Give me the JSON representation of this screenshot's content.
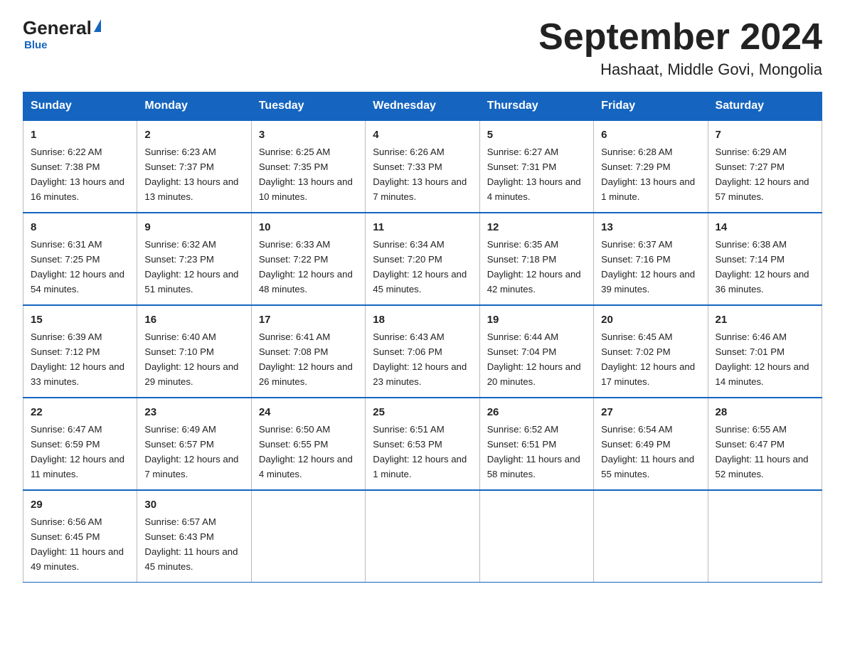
{
  "logo": {
    "general": "General",
    "blue": "Blue",
    "subtitle": "Blue"
  },
  "title": "September 2024",
  "subtitle": "Hashaat, Middle Govi, Mongolia",
  "days": [
    "Sunday",
    "Monday",
    "Tuesday",
    "Wednesday",
    "Thursday",
    "Friday",
    "Saturday"
  ],
  "weeks": [
    [
      {
        "num": "1",
        "sunrise": "6:22 AM",
        "sunset": "7:38 PM",
        "daylight": "13 hours and 16 minutes."
      },
      {
        "num": "2",
        "sunrise": "6:23 AM",
        "sunset": "7:37 PM",
        "daylight": "13 hours and 13 minutes."
      },
      {
        "num": "3",
        "sunrise": "6:25 AM",
        "sunset": "7:35 PM",
        "daylight": "13 hours and 10 minutes."
      },
      {
        "num": "4",
        "sunrise": "6:26 AM",
        "sunset": "7:33 PM",
        "daylight": "13 hours and 7 minutes."
      },
      {
        "num": "5",
        "sunrise": "6:27 AM",
        "sunset": "7:31 PM",
        "daylight": "13 hours and 4 minutes."
      },
      {
        "num": "6",
        "sunrise": "6:28 AM",
        "sunset": "7:29 PM",
        "daylight": "13 hours and 1 minute."
      },
      {
        "num": "7",
        "sunrise": "6:29 AM",
        "sunset": "7:27 PM",
        "daylight": "12 hours and 57 minutes."
      }
    ],
    [
      {
        "num": "8",
        "sunrise": "6:31 AM",
        "sunset": "7:25 PM",
        "daylight": "12 hours and 54 minutes."
      },
      {
        "num": "9",
        "sunrise": "6:32 AM",
        "sunset": "7:23 PM",
        "daylight": "12 hours and 51 minutes."
      },
      {
        "num": "10",
        "sunrise": "6:33 AM",
        "sunset": "7:22 PM",
        "daylight": "12 hours and 48 minutes."
      },
      {
        "num": "11",
        "sunrise": "6:34 AM",
        "sunset": "7:20 PM",
        "daylight": "12 hours and 45 minutes."
      },
      {
        "num": "12",
        "sunrise": "6:35 AM",
        "sunset": "7:18 PM",
        "daylight": "12 hours and 42 minutes."
      },
      {
        "num": "13",
        "sunrise": "6:37 AM",
        "sunset": "7:16 PM",
        "daylight": "12 hours and 39 minutes."
      },
      {
        "num": "14",
        "sunrise": "6:38 AM",
        "sunset": "7:14 PM",
        "daylight": "12 hours and 36 minutes."
      }
    ],
    [
      {
        "num": "15",
        "sunrise": "6:39 AM",
        "sunset": "7:12 PM",
        "daylight": "12 hours and 33 minutes."
      },
      {
        "num": "16",
        "sunrise": "6:40 AM",
        "sunset": "7:10 PM",
        "daylight": "12 hours and 29 minutes."
      },
      {
        "num": "17",
        "sunrise": "6:41 AM",
        "sunset": "7:08 PM",
        "daylight": "12 hours and 26 minutes."
      },
      {
        "num": "18",
        "sunrise": "6:43 AM",
        "sunset": "7:06 PM",
        "daylight": "12 hours and 23 minutes."
      },
      {
        "num": "19",
        "sunrise": "6:44 AM",
        "sunset": "7:04 PM",
        "daylight": "12 hours and 20 minutes."
      },
      {
        "num": "20",
        "sunrise": "6:45 AM",
        "sunset": "7:02 PM",
        "daylight": "12 hours and 17 minutes."
      },
      {
        "num": "21",
        "sunrise": "6:46 AM",
        "sunset": "7:01 PM",
        "daylight": "12 hours and 14 minutes."
      }
    ],
    [
      {
        "num": "22",
        "sunrise": "6:47 AM",
        "sunset": "6:59 PM",
        "daylight": "12 hours and 11 minutes."
      },
      {
        "num": "23",
        "sunrise": "6:49 AM",
        "sunset": "6:57 PM",
        "daylight": "12 hours and 7 minutes."
      },
      {
        "num": "24",
        "sunrise": "6:50 AM",
        "sunset": "6:55 PM",
        "daylight": "12 hours and 4 minutes."
      },
      {
        "num": "25",
        "sunrise": "6:51 AM",
        "sunset": "6:53 PM",
        "daylight": "12 hours and 1 minute."
      },
      {
        "num": "26",
        "sunrise": "6:52 AM",
        "sunset": "6:51 PM",
        "daylight": "11 hours and 58 minutes."
      },
      {
        "num": "27",
        "sunrise": "6:54 AM",
        "sunset": "6:49 PM",
        "daylight": "11 hours and 55 minutes."
      },
      {
        "num": "28",
        "sunrise": "6:55 AM",
        "sunset": "6:47 PM",
        "daylight": "11 hours and 52 minutes."
      }
    ],
    [
      {
        "num": "29",
        "sunrise": "6:56 AM",
        "sunset": "6:45 PM",
        "daylight": "11 hours and 49 minutes."
      },
      {
        "num": "30",
        "sunrise": "6:57 AM",
        "sunset": "6:43 PM",
        "daylight": "11 hours and 45 minutes."
      }
    ]
  ]
}
